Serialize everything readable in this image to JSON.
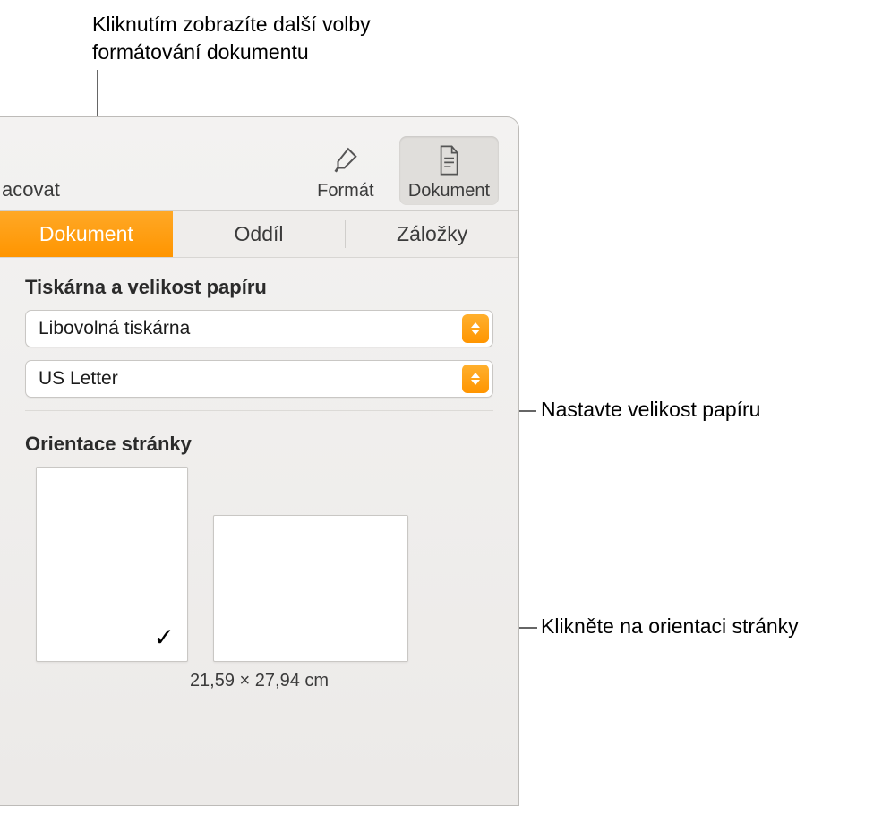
{
  "callouts": {
    "top": "Kliknutím zobrazíte další volby formátování dokumentu",
    "paper_size": "Nastavte velikost papíru",
    "orientation": "Klikněte na orientaci stránky"
  },
  "toolbar": {
    "left_partial_label": "acovat",
    "format_label": "Formát",
    "document_label": "Dokument"
  },
  "tabs": {
    "document": "Dokument",
    "section": "Oddíl",
    "bookmarks": "Záložky"
  },
  "printer_section": {
    "title": "Tiskárna a velikost papíru",
    "printer_value": "Libovolná tiskárna",
    "paper_value": "US Letter"
  },
  "orientation_section": {
    "title": "Orientace stránky",
    "dimensions": "21,59 × 27,94 cm"
  }
}
